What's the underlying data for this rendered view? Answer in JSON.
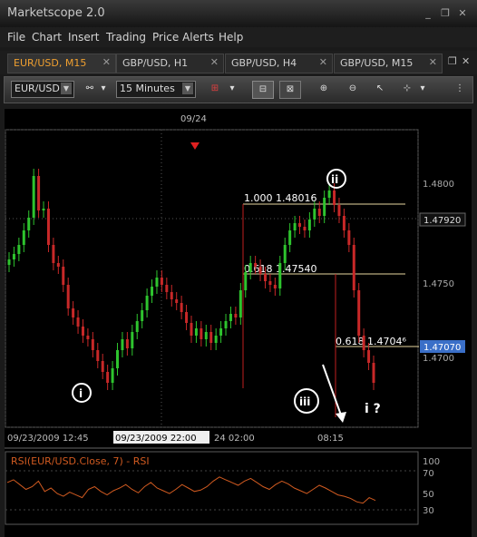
{
  "app": {
    "title": "Marketscope 2.0",
    "min_icon": "_",
    "restore_icon": "❐",
    "close_icon": "✕"
  },
  "menu": {
    "items": [
      "File",
      "Chart",
      "Insert",
      "Trading",
      "Price Alerts",
      "Help"
    ]
  },
  "tabs": [
    {
      "label": "EUR/USD, M15",
      "active": true
    },
    {
      "label": "GBP/USD, H1",
      "active": false
    },
    {
      "label": "GBP/USD, H4",
      "active": false
    },
    {
      "label": "GBP/USD, M15",
      "active": false
    }
  ],
  "toolbar": {
    "instrument": "EUR/USD",
    "timeframe": "15 Minutes"
  },
  "chart": {
    "date_label": "09/24",
    "price_levels": [
      "1.4800",
      "1.4792",
      "1.4750",
      "1.4707",
      "1.4700"
    ],
    "current_price": "1.47920",
    "marker_price": "1.47070",
    "time_labels": [
      "09/23/2009 12:45",
      "09/23/2009 22:00",
      "24 02:00",
      "08:15"
    ],
    "fib_labels": [
      "1.000 1.48016",
      "0.618 1.47540",
      "0.618 1.4704⁶"
    ],
    "wave_labels": [
      "i",
      "ii",
      "iii",
      "i ?"
    ]
  },
  "rsi": {
    "title": "RSI(EUR/USD.Close, 7) - RSI",
    "levels": [
      "100",
      "70",
      "50",
      "30"
    ]
  },
  "chart_data": {
    "type": "candlestick",
    "instrument": "EUR/USD",
    "timeframe": "M15",
    "closes": [
      1.4762,
      1.4765,
      1.477,
      1.4778,
      1.4785,
      1.4808,
      1.4789,
      1.479,
      1.477,
      1.476,
      1.4758,
      1.4748,
      1.4735,
      1.473,
      1.4725,
      1.472,
      1.4718,
      1.4712,
      1.4706,
      1.47,
      1.4694,
      1.4702,
      1.4712,
      1.4718,
      1.4713,
      1.4722,
      1.4728,
      1.4734,
      1.4742,
      1.4747,
      1.4752,
      1.4748,
      1.4744,
      1.474,
      1.4738,
      1.4733,
      1.4727,
      1.472,
      1.4724,
      1.4718,
      1.4722,
      1.4716,
      1.472,
      1.4724,
      1.4728,
      1.4732,
      1.473,
      1.4745,
      1.4755,
      1.476,
      1.4758,
      1.4754,
      1.475,
      1.4748,
      1.4746,
      1.476,
      1.477,
      1.4778,
      1.4782,
      1.478,
      1.4778,
      1.4784,
      1.479,
      1.4786,
      1.4796,
      1.48,
      1.4792,
      1.4786,
      1.4778,
      1.477,
      1.4745,
      1.472,
      1.4712,
      1.4705,
      1.4694
    ],
    "rsi": [
      58,
      62,
      55,
      48,
      52,
      60,
      45,
      50,
      42,
      38,
      44,
      40,
      36,
      48,
      52,
      45,
      40,
      46,
      50,
      55,
      48,
      43,
      52,
      58,
      50,
      46,
      42,
      48,
      55,
      50,
      45,
      47,
      52,
      60,
      66,
      62,
      58,
      54,
      60,
      64,
      58,
      52,
      48,
      55,
      60,
      56,
      50,
      46,
      42,
      48,
      54,
      50,
      45,
      40,
      38,
      35,
      30,
      28,
      36,
      32
    ]
  }
}
